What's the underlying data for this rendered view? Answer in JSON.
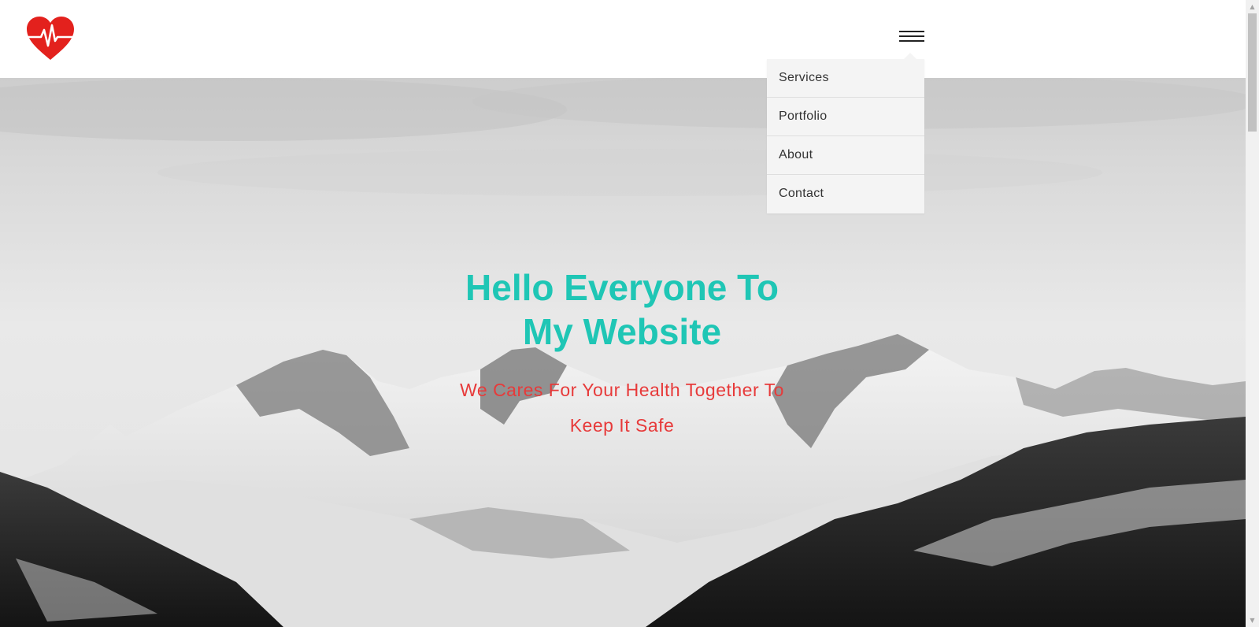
{
  "header": {
    "logo_icon": "heart-pulse-icon",
    "logo_color": "#e3211d",
    "menu_icon": "hamburger-menu-icon"
  },
  "menu": {
    "items": [
      {
        "label": "Services"
      },
      {
        "label": "Portfolio"
      },
      {
        "label": "About"
      },
      {
        "label": "Contact"
      }
    ]
  },
  "hero": {
    "title_line1": "Hello Everyone To",
    "title_line2": "My Website",
    "subtitle_line1": "We Cares For Your Health Together To",
    "subtitle_line2": "Keep It Safe",
    "title_color": "#1fc6b5",
    "subtitle_color": "#e73a3a"
  },
  "scrollbar": {
    "up_icon": "scroll-up-arrow-icon",
    "down_icon": "scroll-down-arrow-icon"
  }
}
